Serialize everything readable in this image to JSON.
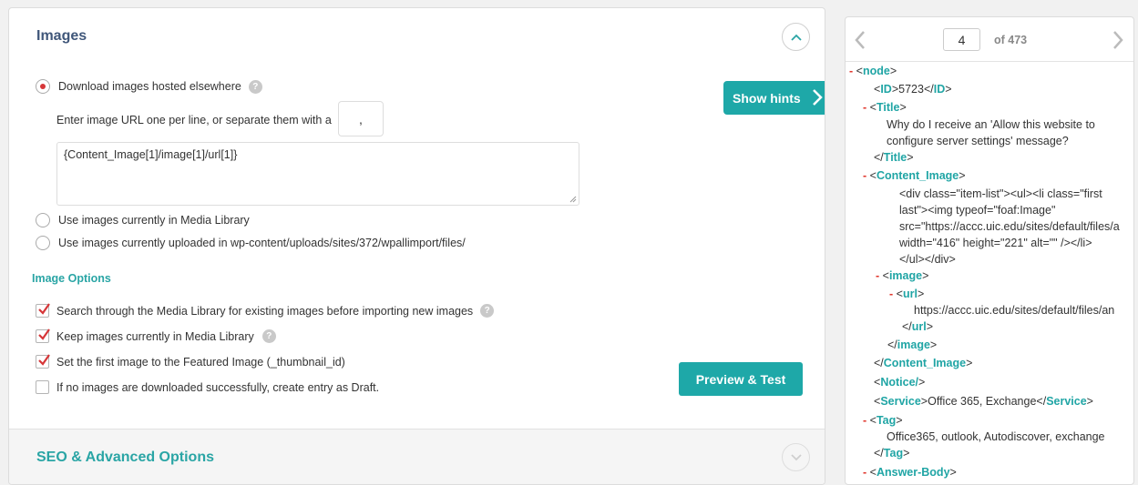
{
  "images_section": {
    "title": "Images",
    "download_option": {
      "label": "Download images hosted elsewhere",
      "separator_label": "Enter image URL one per line, or separate them with a",
      "separator_value": ",",
      "urls_value": "{Content_Image[1]/image[1]/url[1]}"
    },
    "media_library_option": "Use images currently in Media Library",
    "uploaded_option": "Use images currently uploaded in wp-content/uploads/sites/372/wpallimport/files/",
    "help_glyph": "?",
    "options_title": "Image Options",
    "options": [
      {
        "label": "Search through the Media Library for existing images before importing new images",
        "checked": true
      },
      {
        "label": "Keep images currently in Media Library",
        "checked": true
      },
      {
        "label": "Set the first image to the Featured Image (_thumbnail_id)",
        "checked": true
      },
      {
        "label": "If no images are downloaded successfully, create entry as Draft.",
        "checked": false
      }
    ],
    "show_hints_label": "Show hints",
    "preview_label": "Preview & Test"
  },
  "seo_section": {
    "title": "SEO & Advanced Options"
  },
  "record_nav": {
    "current": "4",
    "of_label": "of 473"
  },
  "xml_tree": {
    "minus": "-",
    "node_tag": "node",
    "id_tag": "ID",
    "id_value": "5723",
    "title_tag": "Title",
    "title_line1": "Why do I receive an 'Allow this website to",
    "title_line2": "configure server settings' message?",
    "content_image_tag": "Content_Image",
    "html_line1": "<div class=\"item-list\"><ul><li class=\"first",
    "html_line2": "last\"><img typeof=\"foaf:Image\"",
    "html_line3": "src=\"https://accc.uic.edu/sites/default/files/a",
    "html_line4": "width=\"416\" height=\"221\" alt=\"\" /></li>",
    "html_line5": "</ul></div>",
    "image_tag": "image",
    "url_tag": "url",
    "url_value": "https://accc.uic.edu/sites/default/files/an",
    "notice_tag": "Notice/",
    "service_tag": "Service",
    "service_value": "Office 365, Exchange",
    "tag_tag": "Tag",
    "tag_value": "Office365, outlook, Autodiscover, exchange",
    "answer_body_tag": "Answer-Body"
  },
  "colors": {
    "accent": "#1ea8a8",
    "heading": "#40577a",
    "minus": "#e0352b",
    "radio_dot": "#d63638"
  }
}
